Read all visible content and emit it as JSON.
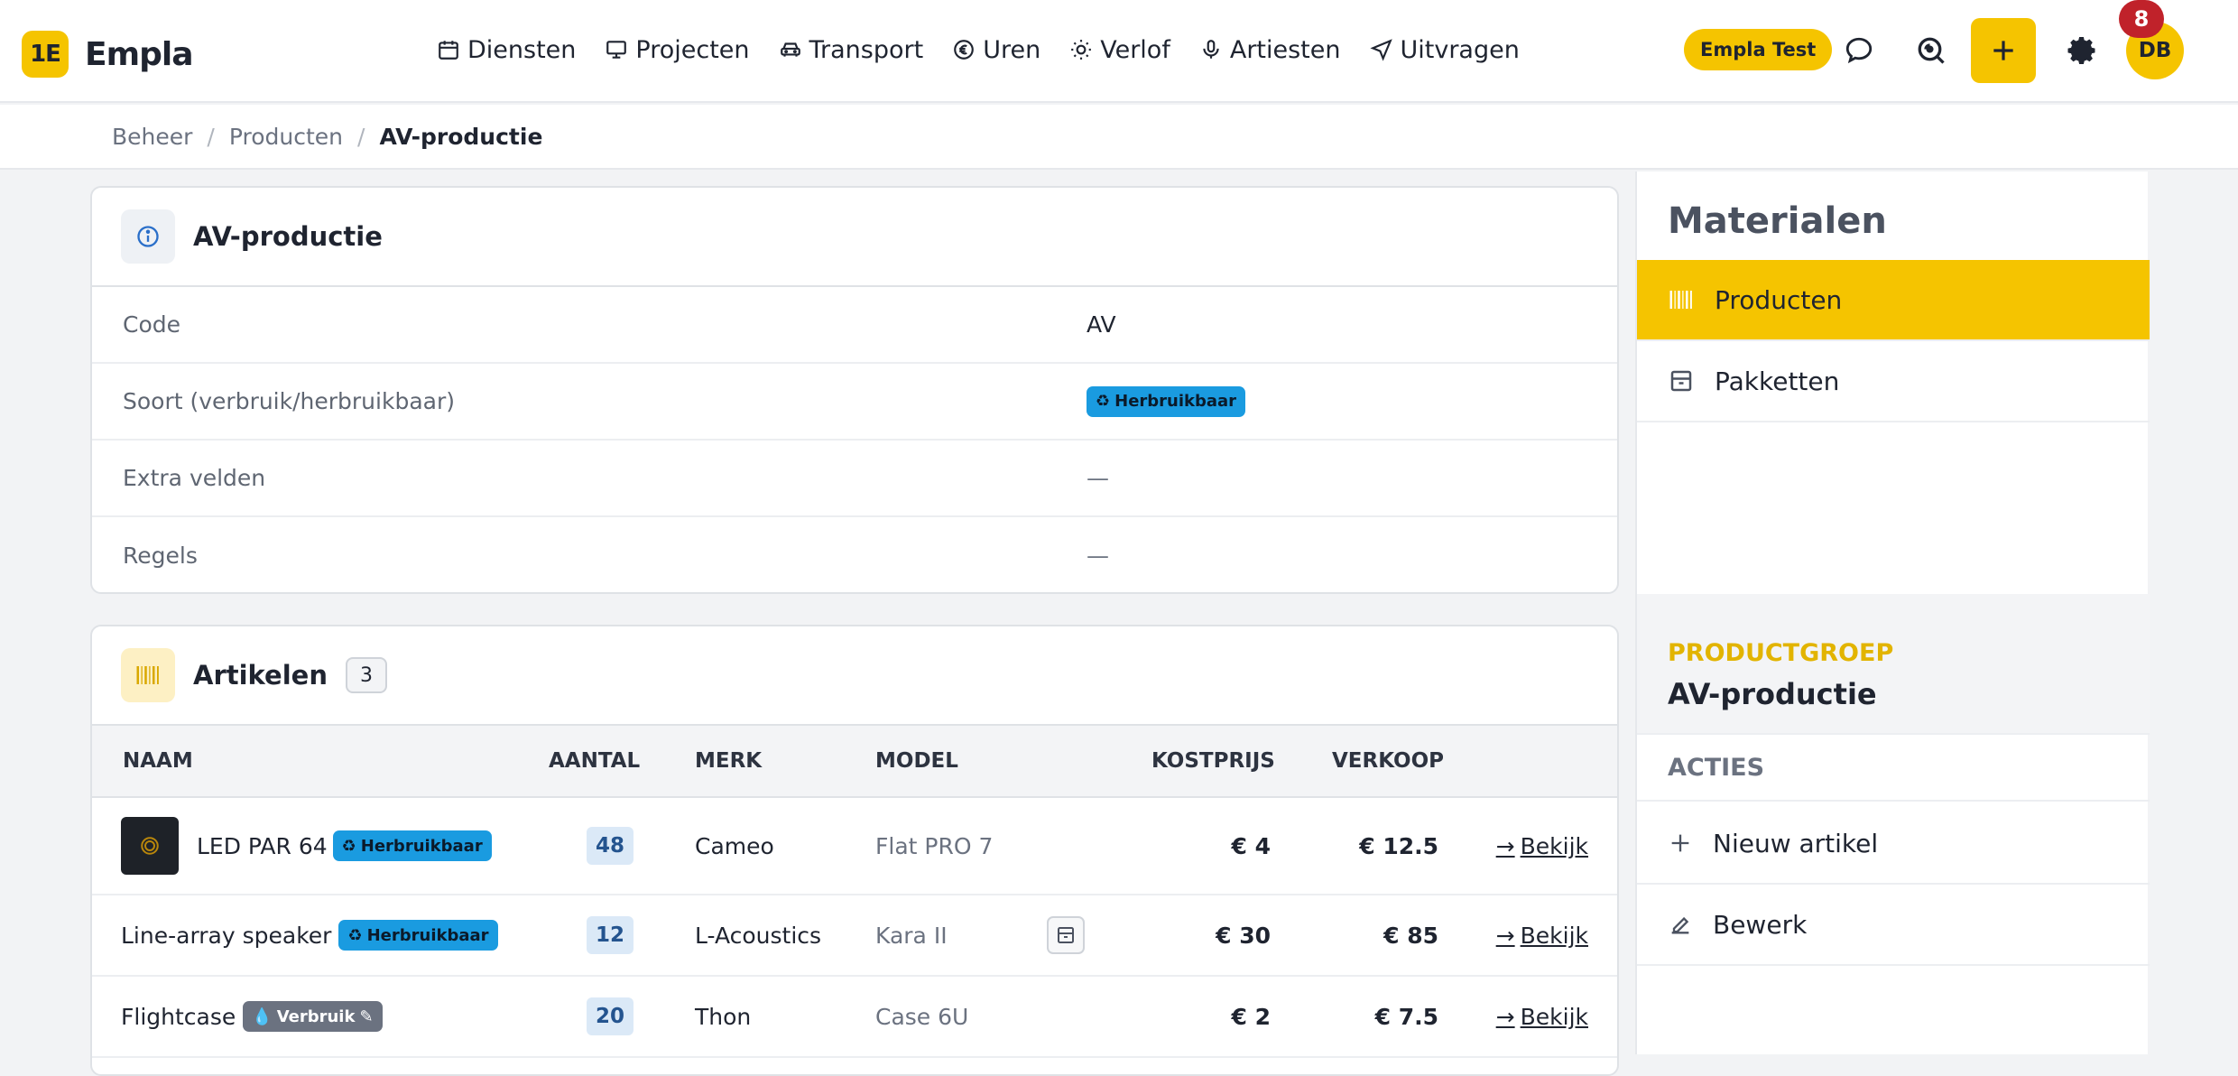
{
  "brand": {
    "mark": "1E",
    "name": "Empla"
  },
  "nav": [
    {
      "label": "Diensten",
      "icon": "calendar-icon"
    },
    {
      "label": "Projecten",
      "icon": "monitor-icon"
    },
    {
      "label": "Transport",
      "icon": "car-icon"
    },
    {
      "label": "Uren",
      "icon": "euro-icon"
    },
    {
      "label": "Verlof",
      "icon": "sun-icon"
    },
    {
      "label": "Artiesten",
      "icon": "microphone-icon"
    },
    {
      "label": "Uitvragen",
      "icon": "send-icon"
    }
  ],
  "header": {
    "env_badge": "Empla Test",
    "avatar": "DB",
    "notifications": "8"
  },
  "breadcrumb": {
    "level1": "Beheer",
    "level2": "Producten",
    "current": "AV-productie"
  },
  "info_card": {
    "title": "AV-productie",
    "rows": {
      "code": {
        "label": "Code",
        "value": "AV"
      },
      "soort": {
        "label": "Soort (verbruik/herbruikbaar)",
        "value": "Herbruikbaar"
      },
      "extra": {
        "label": "Extra velden",
        "value": "—"
      },
      "regels": {
        "label": "Regels",
        "value": "—"
      }
    }
  },
  "articles": {
    "title": "Artikelen",
    "count": "3",
    "columns": {
      "naam": "NAAM",
      "aantal": "AANTAL",
      "merk": "MERK",
      "model": "MODEL",
      "kostprijs": "KOSTPRIJS",
      "verkoop": "VERKOOP"
    },
    "rows": [
      {
        "naam": "LED PAR 64",
        "badge": "Herbruikbaar",
        "aantal": "48",
        "merk": "Cameo",
        "model": "Flat PRO 7",
        "kostprijs": "€ 4",
        "verkoop": "€ 12.5",
        "action": "Bekijk"
      },
      {
        "naam": "Line-array speaker",
        "badge": "Herbruikbaar",
        "aantal": "12",
        "merk": "L-Acoustics",
        "model": "Kara II",
        "kostprijs": "€ 30",
        "verkoop": "€ 85",
        "action": "Bekijk"
      },
      {
        "naam": "Flightcase",
        "badge": "Verbruik",
        "aantal": "20",
        "merk": "Thon",
        "model": "Case 6U",
        "kostprijs": "€ 2",
        "verkoop": "€ 7.5",
        "action": "Bekijk"
      }
    ]
  },
  "sidebar": {
    "title": "Materialen",
    "items": {
      "producten": "Producten",
      "pakketten": "Pakketten"
    },
    "group_label": "PRODUCTGROEP",
    "group_name": "AV-productie",
    "acties": "ACTIES",
    "actions": {
      "nieuw": "Nieuw artikel",
      "bewerk": "Bewerk"
    }
  },
  "colors": {
    "accent": "#f5c400",
    "reusable": "#1a9be0",
    "consumable": "#6b7280",
    "notification": "#c0222a"
  }
}
